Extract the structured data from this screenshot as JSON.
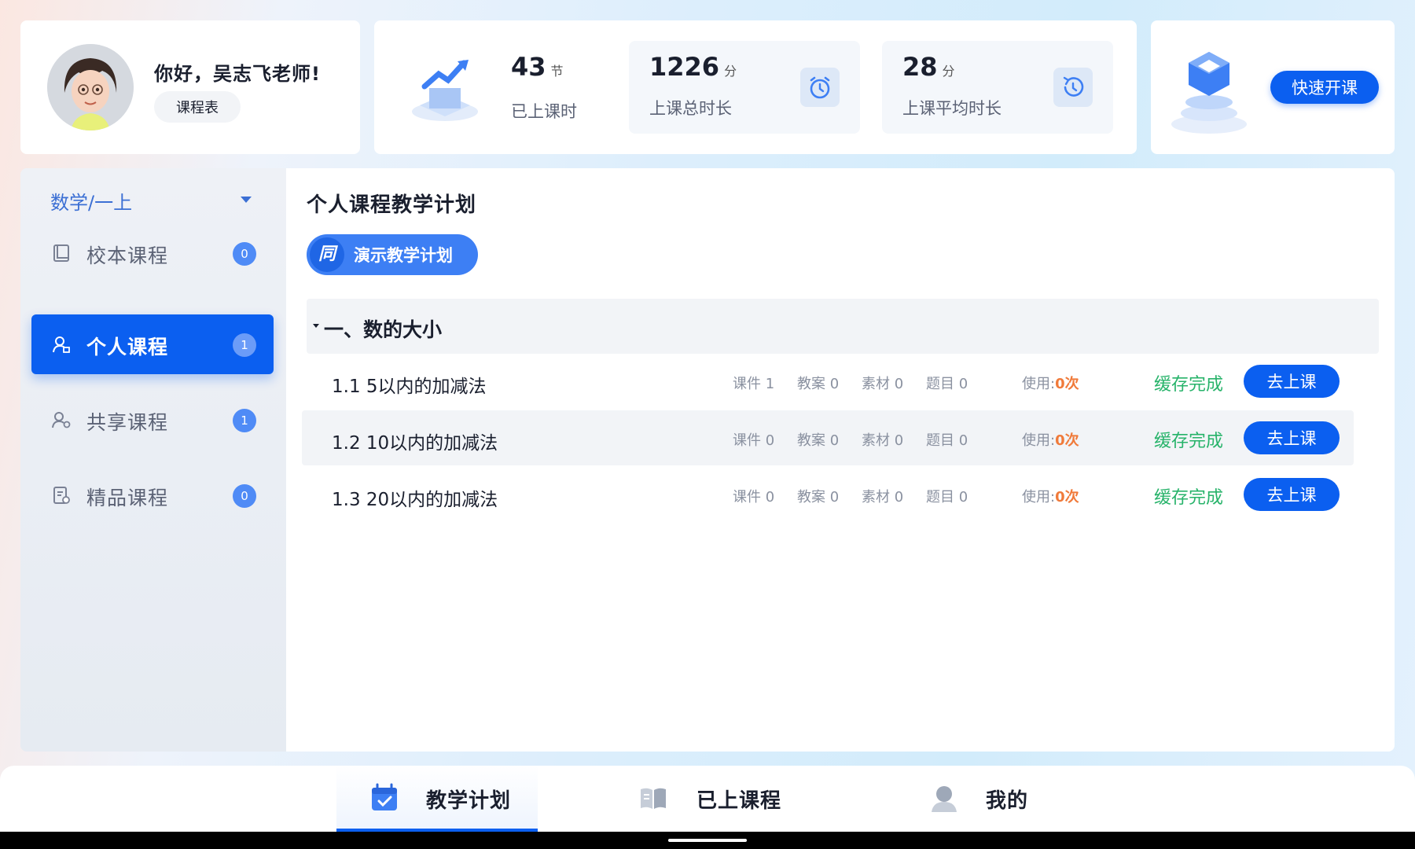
{
  "profile": {
    "greeting": "你好，吴志飞老师!",
    "schedule_button": "课程表"
  },
  "stats": {
    "lessons": {
      "value": "43",
      "unit": "节",
      "label": "已上课时"
    },
    "total_time": {
      "value": "1226",
      "unit": "分",
      "label": "上课总时长"
    },
    "avg_time": {
      "value": "28",
      "unit": "分",
      "label": "上课平均时长"
    }
  },
  "quick_start": {
    "label": "快速开课"
  },
  "sidebar": {
    "subject": "数学/一上",
    "items": [
      {
        "label": "校本课程",
        "badge": "0",
        "icon": "book-icon"
      },
      {
        "label": "个人课程",
        "badge": "1",
        "icon": "user-icon"
      },
      {
        "label": "共享课程",
        "badge": "1",
        "icon": "share-user-icon"
      },
      {
        "label": "精品课程",
        "badge": "0",
        "icon": "document-badge-icon"
      }
    ]
  },
  "main": {
    "title": "个人课程教学计划",
    "demo_button": "演示教学计划",
    "demo_icon": "同",
    "section_title": "一、数的大小",
    "meta_labels": {
      "usage": "使用:"
    },
    "lessons": [
      {
        "title": "1.1 5以内的加减法",
        "courseware": "课件 1",
        "plan": "教案 0",
        "material": "素材 0",
        "questions": "题目 0",
        "usage": "0次",
        "status": "缓存完成",
        "action": "去上课"
      },
      {
        "title": "1.2 10以内的加减法",
        "courseware": "课件 0",
        "plan": "教案 0",
        "material": "素材 0",
        "questions": "题目 0",
        "usage": "0次",
        "status": "缓存完成",
        "action": "去上课"
      },
      {
        "title": "1.3 20以内的加减法",
        "courseware": "课件 0",
        "plan": "教案 0",
        "material": "素材 0",
        "questions": "题目 0",
        "usage": "0次",
        "status": "缓存完成",
        "action": "去上课"
      }
    ]
  },
  "bottom_tabs": [
    {
      "label": "教学计划",
      "icon": "calendar-check-icon",
      "active": true
    },
    {
      "label": "已上课程",
      "icon": "open-book-icon",
      "active": false
    },
    {
      "label": "我的",
      "icon": "person-icon",
      "active": false
    }
  ],
  "colors": {
    "accent": "#0b5ff0",
    "success": "#27b36a",
    "warning": "#f07a3a"
  }
}
